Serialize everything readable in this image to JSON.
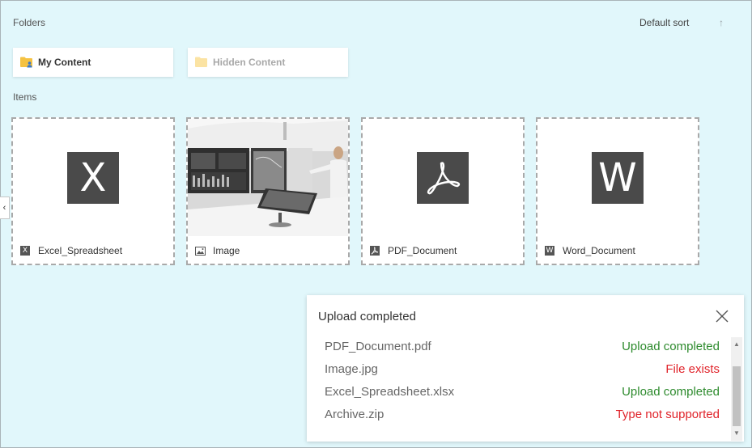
{
  "sections": {
    "folders_label": "Folders",
    "items_label": "Items"
  },
  "sort": {
    "label": "Default sort",
    "direction_icon": "arrow-up-icon"
  },
  "folders": [
    {
      "label": "My Content",
      "icon": "folder-user-icon",
      "color": "#f5c242"
    },
    {
      "label": "Hidden Content",
      "icon": "folder-icon",
      "color": "#fbe3a3"
    }
  ],
  "items": [
    {
      "name": "Excel_Spreadsheet",
      "glyph": "X",
      "icon": "excel-icon"
    },
    {
      "name": "Image",
      "icon": "image-icon"
    },
    {
      "name": "PDF_Document",
      "icon": "pdf-icon"
    },
    {
      "name": "Word_Document",
      "glyph": "W",
      "icon": "word-icon"
    }
  ],
  "upload_panel": {
    "title": "Upload completed",
    "files": [
      {
        "name": "PDF_Document.pdf",
        "status": "Upload completed",
        "status_color": "#2e8b2e"
      },
      {
        "name": "Image.jpg",
        "status": "File exists",
        "status_color": "#e0232a"
      },
      {
        "name": "Excel_Spreadsheet.xlsx",
        "status": "Upload completed",
        "status_color": "#2e8b2e"
      },
      {
        "name": "Archive.zip",
        "status": "Type not supported",
        "status_color": "#e0232a"
      }
    ]
  },
  "colors": {
    "background": "#e1f7fb",
    "success": "#2e8b2e",
    "error": "#e0232a"
  }
}
